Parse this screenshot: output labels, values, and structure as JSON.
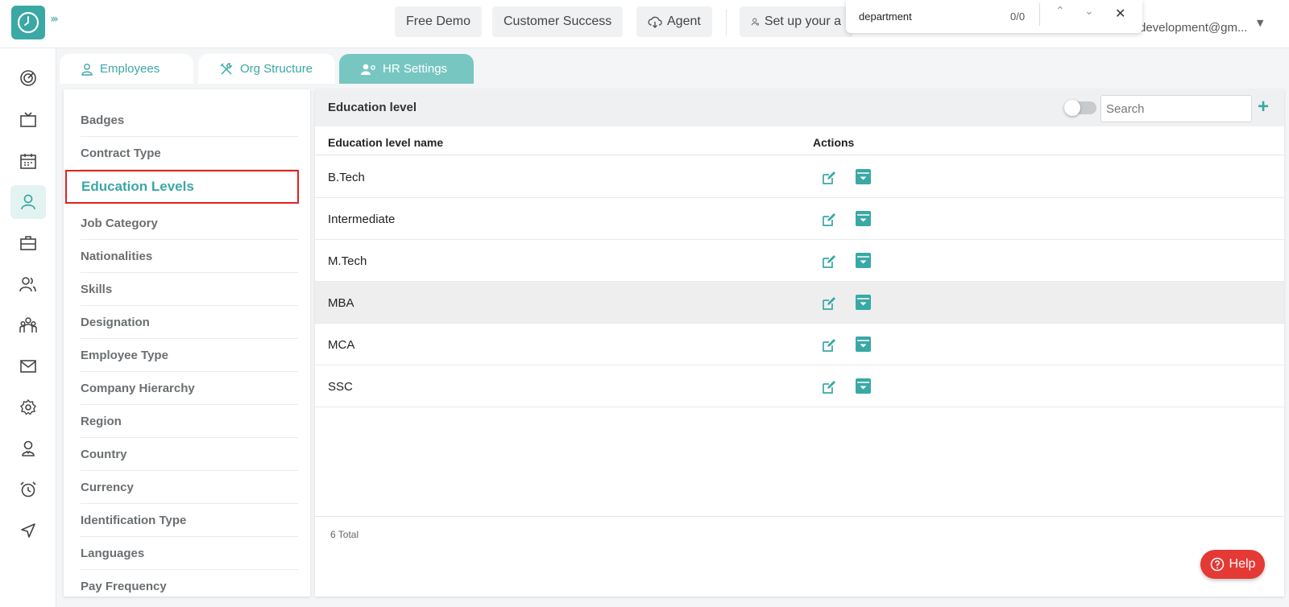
{
  "header": {
    "free_demo": "Free Demo",
    "customer_success": "Customer Success",
    "agent": "Agent",
    "setup": "Set up your a",
    "user_email": "development@gm..."
  },
  "find_bar": {
    "query": "department",
    "count": "0/0"
  },
  "tabs": [
    {
      "label": "Employees"
    },
    {
      "label": "Org Structure"
    },
    {
      "label": "HR Settings"
    }
  ],
  "settings_menu": [
    {
      "label": "Badges"
    },
    {
      "label": "Contract Type"
    },
    {
      "label": "Education Levels"
    },
    {
      "label": "Job Category"
    },
    {
      "label": "Nationalities"
    },
    {
      "label": "Skills"
    },
    {
      "label": "Designation"
    },
    {
      "label": "Employee Type"
    },
    {
      "label": "Company Hierarchy"
    },
    {
      "label": "Region"
    },
    {
      "label": "Country"
    },
    {
      "label": "Currency"
    },
    {
      "label": "Identification Type"
    },
    {
      "label": "Languages"
    },
    {
      "label": "Pay Frequency"
    }
  ],
  "panel": {
    "title": "Education level",
    "search_placeholder": "Search",
    "add": "+",
    "columns": [
      "Education level name",
      "Actions"
    ],
    "rows": [
      {
        "name": "B.Tech"
      },
      {
        "name": "Intermediate"
      },
      {
        "name": "M.Tech"
      },
      {
        "name": "MBA"
      },
      {
        "name": "MCA"
      },
      {
        "name": "SSC"
      }
    ],
    "total": "6 Total"
  },
  "help": {
    "label": "Help"
  },
  "colors": {
    "accent": "#3aa8a4",
    "active_tab": "#77c6c2",
    "highlight_border": "#e02020",
    "help": "#e53935"
  }
}
